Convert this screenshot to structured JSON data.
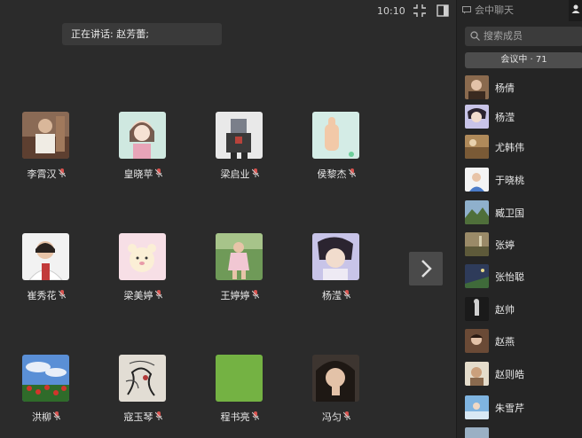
{
  "header": {
    "speaking_label": "正在讲话: 赵芳蕾;",
    "clock": "10:10",
    "compress_icon": "compress-arrows-icon",
    "layout_icon": "side-panel-toggle-icon"
  },
  "participants": [
    {
      "name": "李霄汉"
    },
    {
      "name": "皇晓苹"
    },
    {
      "name": "梁启业"
    },
    {
      "name": "侯黎杰"
    },
    {
      "name": "崔秀花"
    },
    {
      "name": "梁美婷"
    },
    {
      "name": "王婷婷"
    },
    {
      "name": "杨滢"
    },
    {
      "name": "洪柳"
    },
    {
      "name": "寇玉琴"
    },
    {
      "name": "程书亮"
    },
    {
      "name": "冯匀"
    }
  ],
  "pager": {
    "next_icon": "chevron-right-icon"
  },
  "sidebar": {
    "chat_tab_label": "会中聊天",
    "search_placeholder": "搜索成员",
    "status_label": "会议中 · 71",
    "members": [
      {
        "name": "杨倩"
      },
      {
        "name": "杨滢"
      },
      {
        "name": "尤韩伟"
      },
      {
        "name": "于晓桃"
      },
      {
        "name": "臧卫国"
      },
      {
        "name": "张婷"
      },
      {
        "name": "张怡聪"
      },
      {
        "name": "赵帅"
      },
      {
        "name": "赵燕"
      },
      {
        "name": "赵则皓"
      },
      {
        "name": "朱雪芹"
      }
    ]
  },
  "colors": {
    "background": "#2b2b2b",
    "sidebar_background": "#252525",
    "mic_muted": "#d9534f"
  }
}
